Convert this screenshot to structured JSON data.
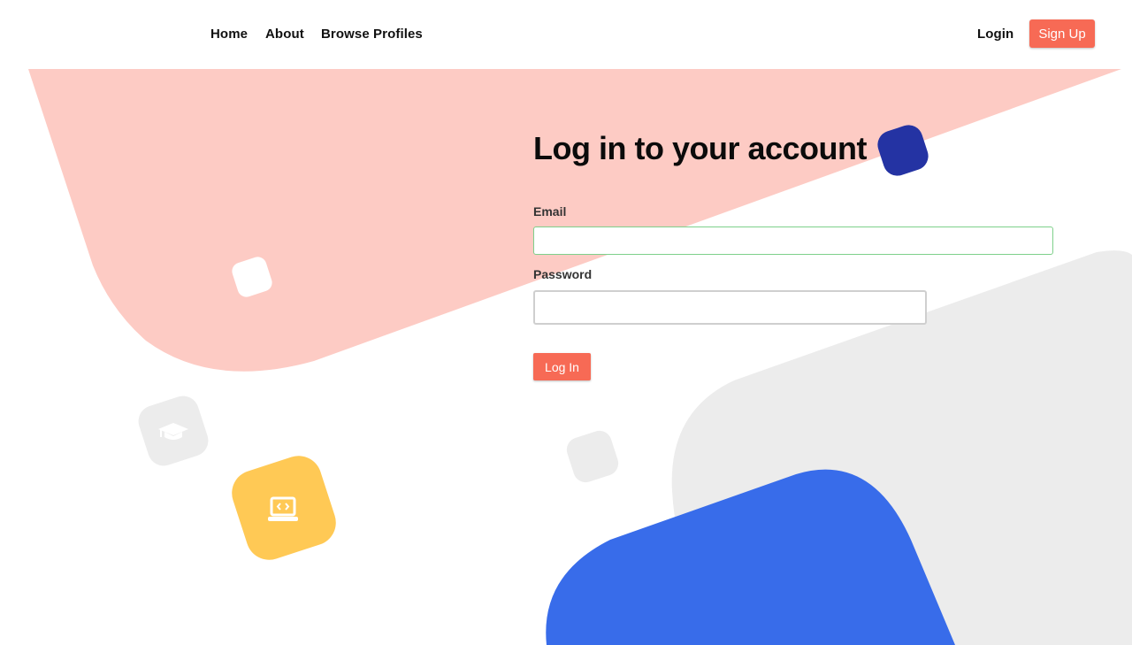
{
  "nav": {
    "links": [
      {
        "label": "Home"
      },
      {
        "label": "About"
      },
      {
        "label": "Browse Profiles"
      }
    ],
    "login_label": "Login",
    "signup_label": "Sign Up"
  },
  "form": {
    "title": "Log in to your account",
    "email_label": "Email",
    "email_value": "",
    "password_label": "Password",
    "password_value": "",
    "submit_label": "Log In"
  },
  "icons": {
    "graduation": "graduation-cap-icon",
    "laptop": "laptop-code-icon"
  },
  "colors": {
    "accent": "#f76a55",
    "salmon_bg": "#fdcbc4",
    "blue_shape": "#386cea",
    "navy_shape": "#2433a3",
    "yellow_shape": "#ffc955",
    "gray_shape": "#ececec",
    "email_border": "#7ed08b"
  }
}
